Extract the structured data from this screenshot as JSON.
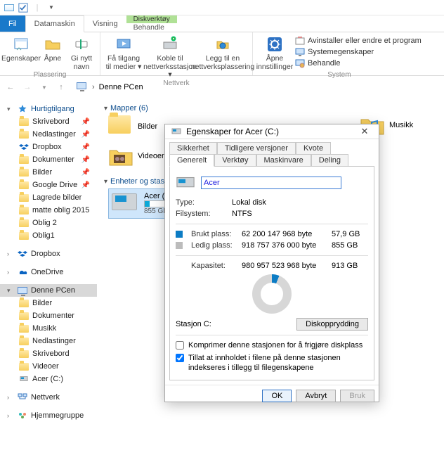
{
  "titlebar": {},
  "tabs": {
    "file": "Fil",
    "datamaskin": "Datamaskin",
    "visning": "Visning",
    "green": "Diskverktøy",
    "green_sub": "Behandle"
  },
  "ribbon": {
    "loc": {
      "egenskaper": "Egenskaper",
      "apne": "Åpne",
      "gi_nytt": "Gi nytt navn",
      "cap": "Plassering"
    },
    "net": {
      "tilgang": "Få tilgang til medier ▾",
      "koble": "Koble til nettverksstasjon ▾",
      "legg": "Legg til en nettverksplassering",
      "cap": "Nettverk"
    },
    "sys": {
      "apne_inn": "Åpne innstillinger",
      "avinstall": "Avinstaller eller endre et program",
      "sysegen": "Systemegenskaper",
      "behandle": "Behandle",
      "cap": "System"
    }
  },
  "addr": {
    "text": "Denne PCen"
  },
  "side": {
    "quick": "Hurtigtilgang",
    "quick_items": [
      "Skrivebord",
      "Nedlastinger",
      "Dropbox",
      "Dokumenter",
      "Bilder",
      "Google Drive",
      "Lagrede bilder",
      "matte oblig  2015",
      "Oblig 2",
      "Oblig1"
    ],
    "dropbox": "Dropbox",
    "onedrive": "OneDrive",
    "thispc": "Denne PCen",
    "pc_items": [
      "Bilder",
      "Dokumenter",
      "Musikk",
      "Nedlastinger",
      "Skrivebord",
      "Videoer",
      "Acer (C:)"
    ],
    "network": "Nettverk",
    "homegroup": "Hjemmegruppe"
  },
  "content": {
    "mapper_hdr": "Mapper (6)",
    "folders": [
      "Bilder",
      "Videoer",
      "Musikk"
    ],
    "enheter_hdr": "Enheter og stasjoner",
    "drive": {
      "name": "Acer (C:)",
      "cap": "855 GB ledig",
      "fill_pct": 6
    }
  },
  "dialog": {
    "title": "Egenskaper for Acer (C:)",
    "tabs_row1": [
      "Sikkerhet",
      "Tidligere versjoner",
      "Kvote"
    ],
    "tabs_row2": [
      "Generelt",
      "Verktøy",
      "Maskinvare",
      "Deling"
    ],
    "active_tab": "Generelt",
    "name_value": "Acer",
    "type_k": "Type:",
    "type_v": "Lokal disk",
    "fs_k": "Filsystem:",
    "fs_v": "NTFS",
    "used_k": "Brukt plass:",
    "used_b": "62 200 147 968 byte",
    "used_h": "57,9 GB",
    "free_k": "Ledig plass:",
    "free_b": "918 757 376 000 byte",
    "free_h": "855 GB",
    "cap_k": "Kapasitet:",
    "cap_b": "980 957 523 968 byte",
    "cap_h": "913 GB",
    "station": "Stasjon C:",
    "cleanup": "Diskopprydding",
    "chk1": "Komprimer denne stasjonen for å frigjøre diskplass",
    "chk2": "Tillat at innholdet i filene på denne stasjonen indekseres i tillegg til filegenskapene",
    "ok": "OK",
    "cancel": "Avbryt",
    "apply": "Bruk"
  }
}
